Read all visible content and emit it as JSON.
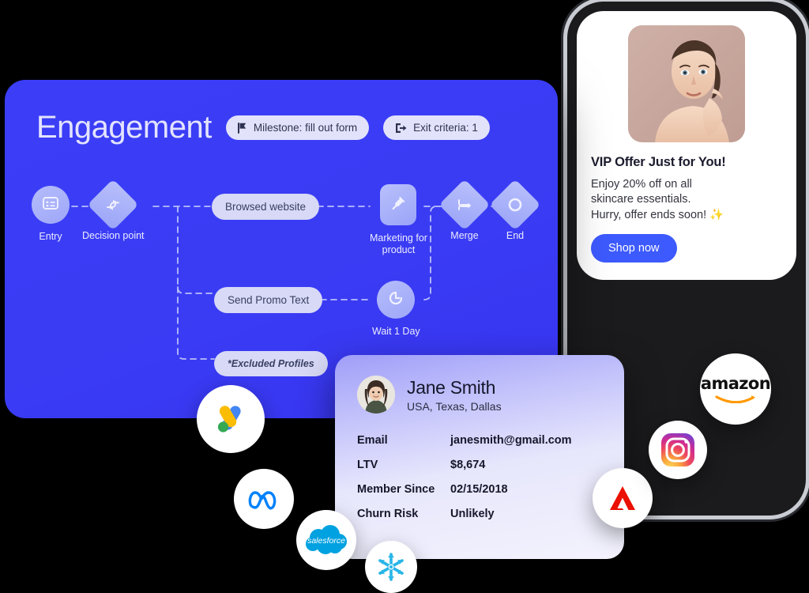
{
  "flow": {
    "title": "Engagement",
    "pills": [
      {
        "label": "Milestone: fill out form",
        "icon": "flag-icon"
      },
      {
        "label": "Exit criteria: 1",
        "icon": "exit-icon"
      }
    ],
    "nodes": [
      {
        "id": "entry",
        "label": "Entry",
        "icon": "form-icon"
      },
      {
        "id": "decision",
        "label": "Decision point",
        "icon": "branch-icon"
      },
      {
        "id": "marketing",
        "label": "Marketing for\nproduct",
        "icon": "plug-icon"
      },
      {
        "id": "merge",
        "label": "Merge",
        "icon": "merge-icon"
      },
      {
        "id": "end",
        "label": "End",
        "icon": "ring-icon"
      },
      {
        "id": "wait",
        "label": "Wait 1 Day",
        "icon": "timer-icon"
      }
    ],
    "tags": [
      {
        "id": "browsed",
        "label": "Browsed website"
      },
      {
        "id": "promo",
        "label": "Send Promo Text"
      },
      {
        "id": "excluded",
        "label": "*Excluded Profiles"
      }
    ]
  },
  "push": {
    "title": "VIP Offer Just for You!",
    "body": "Enjoy 20% off on all\nskincare essentials.\nHurry, offer ends soon! ✨",
    "cta": "Shop now"
  },
  "profile": {
    "name": "Jane Smith",
    "location": "USA, Texas, Dallas",
    "rows": [
      {
        "key": "Email",
        "value": "janesmith@gmail.com"
      },
      {
        "key": "LTV",
        "value": "$8,674"
      },
      {
        "key": "Member Since",
        "value": "02/15/2018"
      },
      {
        "key": "Churn Risk",
        "value": "Unlikely"
      }
    ]
  },
  "logos": [
    {
      "id": "google-ads",
      "name": "google-ads-logo"
    },
    {
      "id": "meta",
      "name": "meta-logo"
    },
    {
      "id": "salesforce",
      "name": "salesforce-logo",
      "text": "salesforce"
    },
    {
      "id": "snowflake",
      "name": "snowflake-logo"
    },
    {
      "id": "adobe",
      "name": "adobe-logo"
    },
    {
      "id": "instagram",
      "name": "instagram-logo"
    },
    {
      "id": "amazon",
      "name": "amazon-logo",
      "text": "amazon"
    }
  ],
  "colors": {
    "panel_blue": "#3b3ef6",
    "accent_button": "#3d5afe",
    "pill_bg": "#d7d9f6",
    "node_fill": "#b5bcfb"
  }
}
